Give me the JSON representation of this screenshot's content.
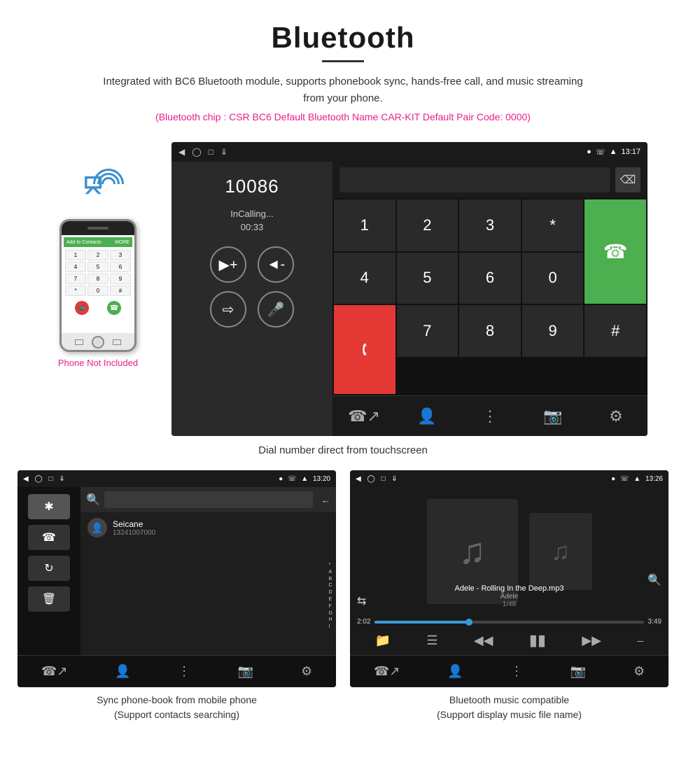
{
  "page": {
    "title": "Bluetooth",
    "description": "Integrated with BC6 Bluetooth module, supports phonebook sync, hands-free call, and music streaming from your phone.",
    "info_line": "(Bluetooth chip : CSR BC6    Default Bluetooth Name CAR-KIT    Default Pair Code: 0000)",
    "screen_caption": "Dial number direct from touchscreen",
    "phonebook_caption_line1": "Sync phone-book from mobile phone",
    "phonebook_caption_line2": "(Support contacts searching)",
    "music_caption_line1": "Bluetooth music compatible",
    "music_caption_line2": "(Support display music file name)"
  },
  "dial_screen": {
    "number": "10086",
    "status": "InCalling...",
    "timer": "00:33",
    "status_bar_time": "13:17"
  },
  "phonebook_screen": {
    "status_bar_time": "13:20",
    "contact_name": "Seicane",
    "contact_number": "13241007000"
  },
  "music_screen": {
    "status_bar_time": "13:26",
    "song_title": "Adele - Rolling In the Deep.mp3",
    "artist": "Adele",
    "track_position": "1/48",
    "time_current": "2:02",
    "time_total": "3:49"
  },
  "phone_mock": {
    "not_included": "Phone Not Included"
  },
  "keypad": {
    "keys": [
      "1",
      "2",
      "3",
      "*",
      "4",
      "5",
      "6",
      "0",
      "7",
      "8",
      "9",
      "#"
    ]
  }
}
